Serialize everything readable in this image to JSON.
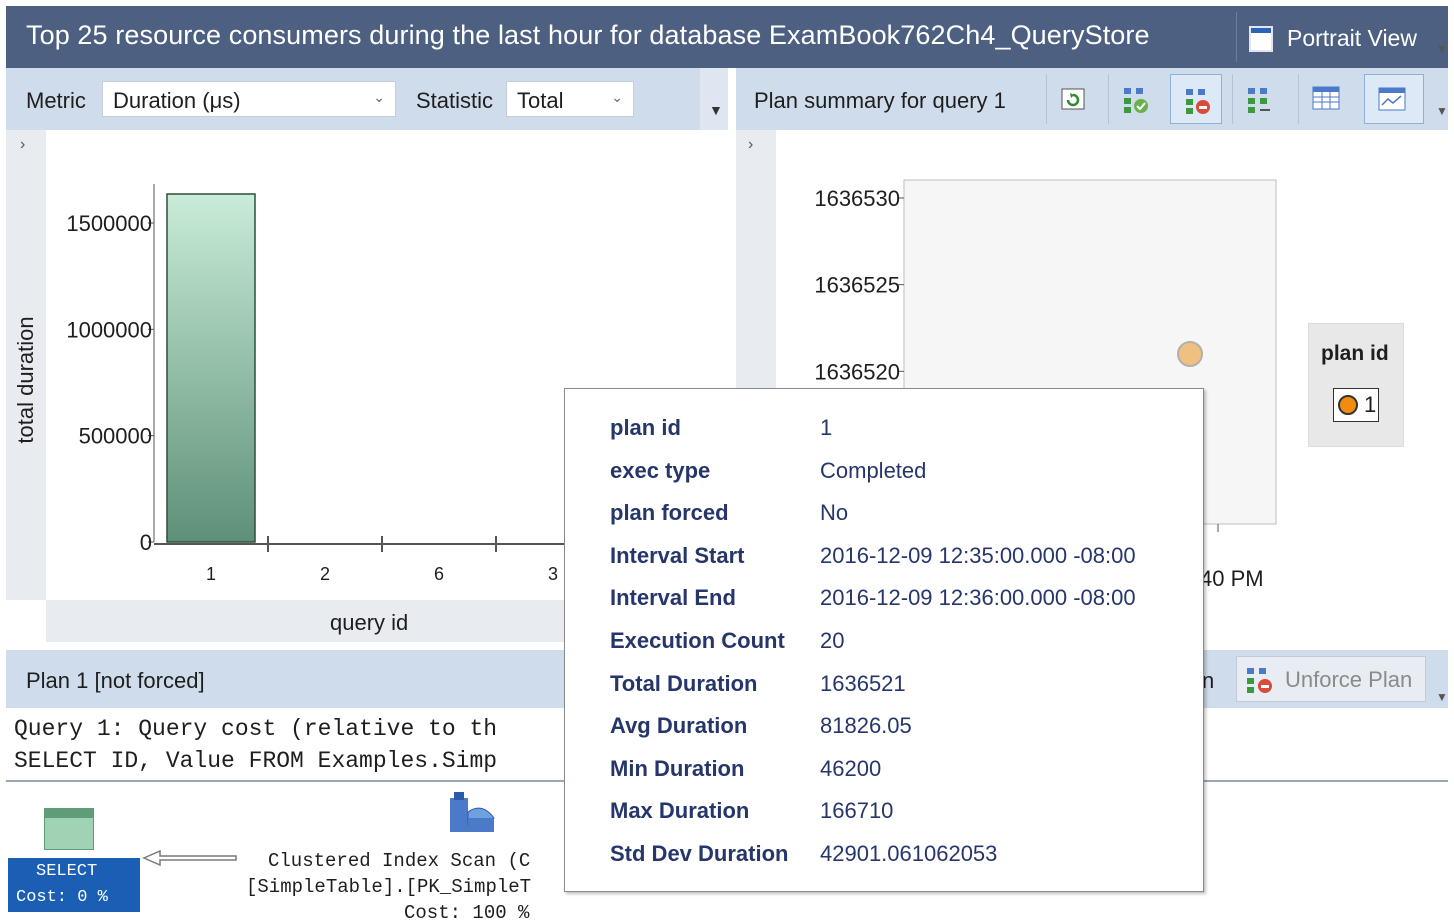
{
  "window": {
    "title": "Top 25 resource consumers during the last hour for database ExamBook762Ch4_QueryStore",
    "portrait_view_label": "Portrait View"
  },
  "left_toolbar": {
    "metric_label": "Metric",
    "metric_value": "Duration (μs)",
    "statistic_label": "Statistic",
    "statistic_value": "Total"
  },
  "right_toolbar": {
    "plan_summary_label": "Plan summary for query 1",
    "icons": [
      "refresh-icon",
      "force-plan-icon",
      "unforce-plan-icon",
      "compare-plans-icon",
      "grid-view-icon",
      "chart-view-icon"
    ]
  },
  "left_chart": {
    "ytick_labels": [
      "1500000",
      "1000000",
      "500000",
      "0"
    ],
    "xtick_labels": [
      "1",
      "2",
      "6",
      "3"
    ]
  },
  "right_chart": {
    "ytick_labels": [
      "1636530",
      "1636525",
      "1636520"
    ],
    "time_label_fragment": "40 PM",
    "legend_title": "plan id",
    "legend_value": "1"
  },
  "chart_data": [
    {
      "type": "bar",
      "title": "",
      "xlabel": "query id",
      "ylabel": "total duration",
      "categories": [
        "1",
        "2",
        "6",
        "3"
      ],
      "values": [
        1636521,
        0,
        0,
        0
      ],
      "ylim": [
        0,
        1636521
      ],
      "grid": false,
      "bar_color": "#6aa88a"
    },
    {
      "type": "scatter",
      "ylabel_fragment": "",
      "points": [
        {
          "plan_id": "1",
          "y": 1636521
        }
      ],
      "ylim": [
        1636517,
        1636531
      ],
      "legend_placement": "right",
      "marker_color": "#f0c080"
    }
  ],
  "plan_bar": {
    "plan_label": "Plan 1 [not forced]",
    "force_label_fragment": "n",
    "unforce_label": "Unforce Plan"
  },
  "query_text": {
    "line1": "Query 1: Query cost (relative to th",
    "line2": "SELECT ID, Value FROM Examples.Simp"
  },
  "exec_plan": {
    "select_label": "SELECT",
    "select_cost": "Cost: 0 %",
    "scan_line1": "Clustered Index Scan (C",
    "scan_line2": "[SimpleTable].[PK_SimpleT",
    "scan_line2_tail": "____ __,",
    "scan_cost": "Cost: 100 %"
  },
  "tooltip": {
    "rows": [
      {
        "key": "plan id",
        "value": "1"
      },
      {
        "key": "exec type",
        "value": "Completed"
      },
      {
        "key": "plan forced",
        "value": "No"
      },
      {
        "key": "Interval Start",
        "value": "2016-12-09 12:35:00.000 -08:00"
      },
      {
        "key": "Interval End",
        "value": "2016-12-09 12:36:00.000 -08:00"
      },
      {
        "key": "Execution Count",
        "value": "20"
      },
      {
        "key": "Total Duration",
        "value": "1636521"
      },
      {
        "key": "Avg Duration",
        "value": "81826.05"
      },
      {
        "key": "Min Duration",
        "value": "46200"
      },
      {
        "key": "Max Duration",
        "value": "166710"
      },
      {
        "key": "Std Dev Duration",
        "value": "42901.061062053"
      }
    ]
  },
  "colors": {
    "title_bar": "#4d6082",
    "toolbar": "#cfdcec",
    "tooltip_text": "#26366b",
    "select_box": "#1b5fb5"
  }
}
